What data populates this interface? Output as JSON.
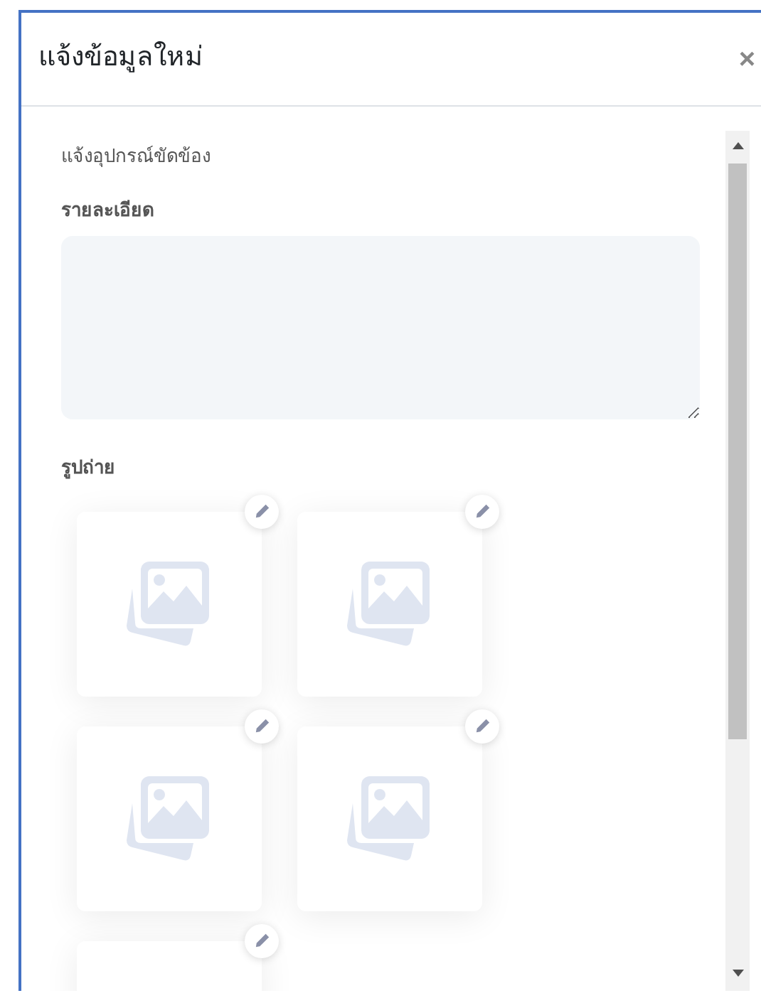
{
  "dialog": {
    "title": "แจ้งข้อมูลใหม่",
    "close": "×"
  },
  "form": {
    "section_label": "แจ้งอุปกรณ์ขัดข้อง",
    "details_label": "รายละเอียด",
    "photos_label": "รูปถ่าย",
    "photos": [
      {
        "kind": "empty"
      },
      {
        "kind": "empty"
      },
      {
        "kind": "empty"
      },
      {
        "kind": "empty"
      },
      {
        "kind": "empty"
      }
    ]
  }
}
